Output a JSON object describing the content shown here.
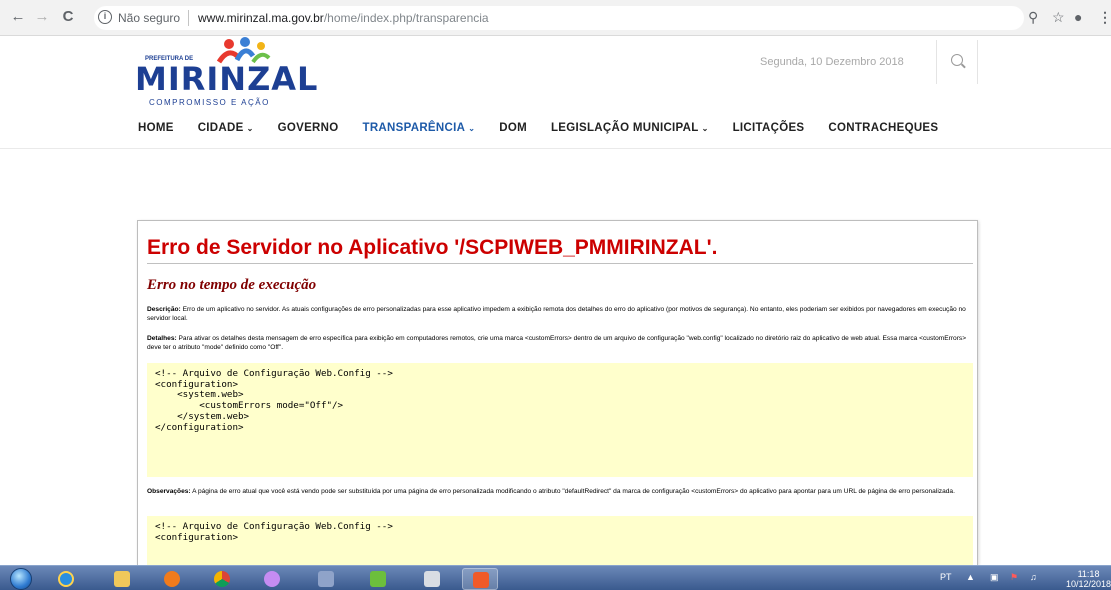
{
  "browser": {
    "security_label": "Não seguro",
    "url_host": "www.mirinzal.ma.gov.br",
    "url_path": "/home/index.php/transparencia",
    "back_icon": "←",
    "forward_icon": "→",
    "reload_icon": "C",
    "info_icon": "i"
  },
  "site": {
    "logo_main": "MIRINZAL",
    "logo_prefix": "PREFEITURA DE",
    "logo_tagline": "COMPROMISSO E AÇÃO",
    "date": "Segunda, 10 Dezembro 2018",
    "menu": [
      {
        "label": "HOME"
      },
      {
        "label": "CIDADE"
      },
      {
        "label": "GOVERNO"
      },
      {
        "label": "TRANSPARÊNCIA"
      },
      {
        "label": "DOM"
      },
      {
        "label": "LEGISLAÇÃO MUNICIPAL"
      },
      {
        "label": "LICITAÇÕES"
      },
      {
        "label": "CONTRACHEQUES"
      }
    ],
    "caret": "⌄",
    "accent_color": "#1d5aa8",
    "brand_color": "#1d3f93"
  },
  "error": {
    "title": "Erro de Servidor no Aplicativo '/SCPIWEB_PMMIRINZAL'.",
    "subtitle": "Erro no tempo de execução",
    "desc_label": "Descrição:",
    "desc_text": " Erro de um aplicativo no servidor. As atuais configurações de erro personalizadas para esse aplicativo impedem a exibição remota dos detalhes do erro do aplicativo (por motivos de segurança). No entanto, eles poderiam ser exibidos por navegadores em execução no servidor local.",
    "details_label": "Detalhes:",
    "details_text": " Para ativar os detalhes desta mensagem de erro específica para exibição em computadores remotos, crie uma marca <customErrors> dentro de um arquivo de configuração \"web.config\" localizado no diretório raiz do aplicativo de web atual. Essa marca <customErrors> deve ter o atributo \"mode\" definido como \"Off\".",
    "code1": [
      "",
      "<!-- Arquivo de Configuração Web.Config -->",
      "",
      "<configuration>",
      "    <system.web>",
      "        <customErrors mode=\"Off\"/>",
      "    </system.web>",
      "</configuration>",
      ""
    ],
    "notes_label": "Observações:",
    "notes_text": " A página de erro atual que você está vendo pode ser substituída por uma página de erro personalizada modificando o atributo \"defaultRedirect\" da marca de configuração <customErrors> do aplicativo para apontar para um URL de página de erro personalizada.",
    "code2": [
      "",
      "<!-- Arquivo de Configuração Web.Config -->",
      "",
      "<configuration>"
    ],
    "title_color": "#cc0000",
    "code_bg": "#ffffcc"
  },
  "taskbar": {
    "lang": "PT",
    "time": "11:18",
    "date": "10/12/2018",
    "apps": [
      "ie",
      "explorer",
      "media-player",
      "chrome",
      "paint",
      "network",
      "green-app",
      "calculator",
      "orange-app"
    ]
  }
}
